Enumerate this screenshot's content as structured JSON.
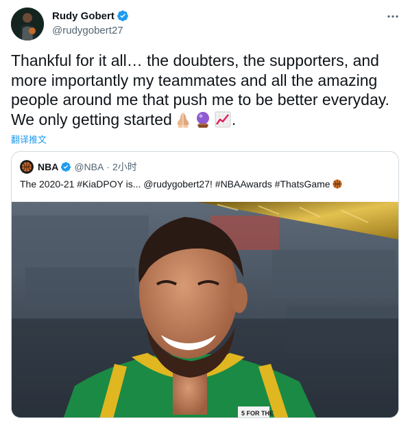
{
  "tweet": {
    "author_name": "Rudy Gobert",
    "author_handle": "@rudygobert27",
    "text": "Thankful for it all… the doubters, the supporters, and more importantly my teammates and all the amazing people around me that push me to be better everyday. We only getting started",
    "text_end": ".",
    "emojis": [
      "folded-hands-icon",
      "crystal-ball-icon",
      "chart-increasing-icon"
    ],
    "translate_label": "翻译推文"
  },
  "quoted": {
    "author_name": "NBA",
    "author_handle": "@NBA",
    "separator": "·",
    "time": "2小时",
    "text": "The 2020-21 #KiaDPOY is... @rudygobert27! #NBAAwards #ThatsGame",
    "emoji": "basketball-icon",
    "image": {
      "description": "smiling basketball player in green jersey",
      "jersey_patch": "5 FOR THE"
    }
  },
  "colors": {
    "link": "#1d9bf0",
    "verified": "#1d9bf0",
    "secondary_text": "#536471",
    "jersey_green": "#0d7a3b",
    "gold": "#c9a227"
  }
}
